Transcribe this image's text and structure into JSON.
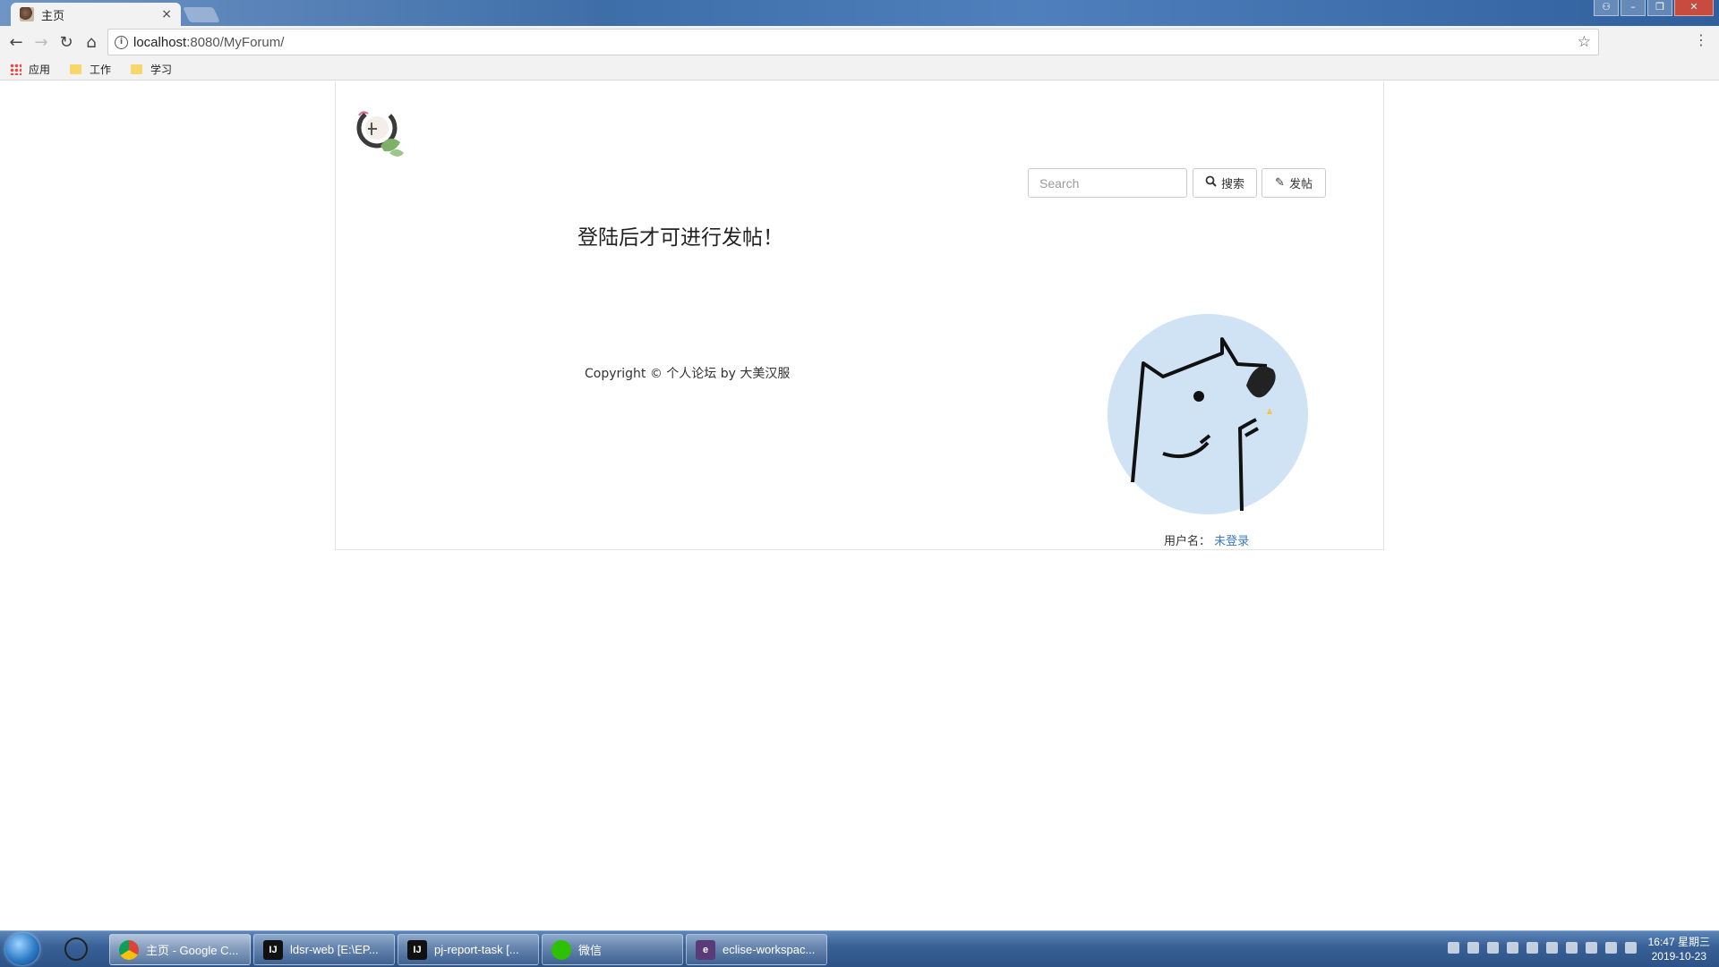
{
  "browser": {
    "tab": {
      "title": "主页",
      "close": "×"
    },
    "url": {
      "host": "localhost",
      "path": ":8080/MyForum/"
    },
    "bookmarks": [
      {
        "label": "应用"
      },
      {
        "label": "工作"
      },
      {
        "label": "学习"
      }
    ]
  },
  "page": {
    "search": {
      "placeholder": "Search",
      "button_label": "搜索"
    },
    "post_button_label": "发帖",
    "notice": "登陆后才可进行发帖！",
    "copyright": "Copyright © 个人论坛 by 大美汉服",
    "user": {
      "label": "用户名：",
      "status": "未登录"
    }
  },
  "taskbar": {
    "tasks": [
      {
        "label": "主页 - Google C..."
      },
      {
        "label": "ldsr-web [E:\\EP..."
      },
      {
        "label": "pj-report-task [..."
      },
      {
        "label": "微信"
      },
      {
        "label": "eclise-workspac..."
      }
    ],
    "clock": {
      "time": "16:47 星期三",
      "date": "2019-10-23"
    }
  },
  "colors": {
    "link": "#3a7bbf",
    "avatar_bg": "#cfe3f5"
  }
}
